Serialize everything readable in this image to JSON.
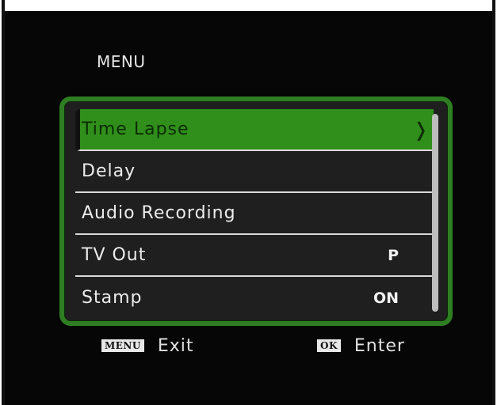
{
  "menu": {
    "title": "MENU",
    "items": [
      {
        "label": "Time Lapse",
        "value": "",
        "selected": true,
        "chevron": "❭"
      },
      {
        "label": "Delay",
        "value": ""
      },
      {
        "label": "Audio Recording",
        "value": ""
      },
      {
        "label": "TV Out",
        "value": "P"
      },
      {
        "label": "Stamp",
        "value": "ON"
      }
    ]
  },
  "footer": {
    "exit_key": "MENU",
    "exit_label": "Exit",
    "enter_key": "OK",
    "enter_label": "Enter"
  },
  "colors": {
    "accent_green": "#2e7d22",
    "selected_green": "#2f8f1a",
    "background": "#060606"
  }
}
